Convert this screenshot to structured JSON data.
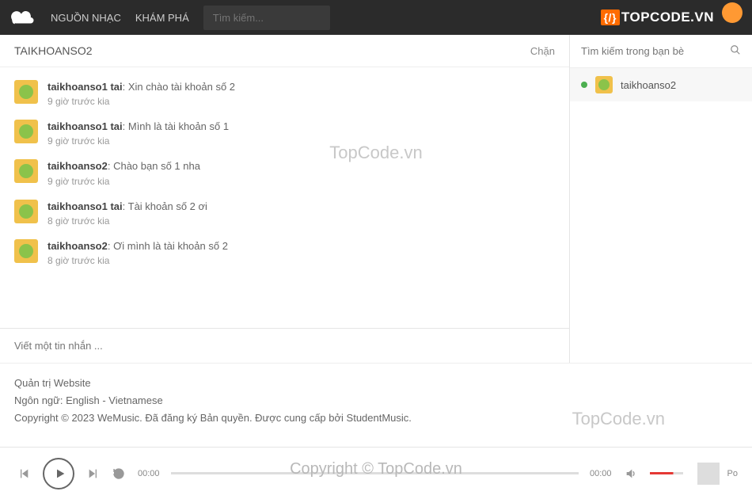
{
  "nav": {
    "link1": "NGUỒN NHẠC",
    "link2": "KHÁM PHÁ",
    "search_placeholder": "Tìm kiếm..."
  },
  "brand": {
    "text": "TOPCODE.VN"
  },
  "chat": {
    "title": "TAIKHOANSO2",
    "block": "Chặn",
    "compose_placeholder": "Viết một tin nhắn ..."
  },
  "messages": [
    {
      "user": "taikhoanso1 tai",
      "text": ": Xin chào tài khoản số 2",
      "time": "9 giờ trước kia"
    },
    {
      "user": "taikhoanso1 tai",
      "text": ": Mình là tài khoản số 1",
      "time": "9 giờ trước kia"
    },
    {
      "user": "taikhoanso2",
      "text": ": Chào bạn số 1 nha",
      "time": "9 giờ trước kia"
    },
    {
      "user": "taikhoanso1 tai",
      "text": ": Tài khoản số 2 ơi",
      "time": "8 giờ trước kia"
    },
    {
      "user": "taikhoanso2",
      "text": ": Ơi mình là tài khoản số 2",
      "time": "8 giờ trước kia"
    }
  ],
  "friends": {
    "search_placeholder": "Tìm kiếm trong bạn bè",
    "items": [
      {
        "name": "taikhoanso2"
      }
    ]
  },
  "footer": {
    "admin": "Quản trị Website",
    "lang_label": "Ngôn ngữ:",
    "lang_en": "English",
    "lang_sep": " - ",
    "lang_vi": "Vietnamese",
    "copyright_a": "Copyright © 2023 WeMusic. Đã đăng ký Bản quyền. Được cung cấp bởi ",
    "copyright_b": "StudentMusic",
    "copyright_c": "."
  },
  "player": {
    "time_start": "00:00",
    "time_end": "00:00",
    "right": "Po"
  },
  "watermarks": {
    "mid": "TopCode.vn",
    "br": "TopCode.vn",
    "player": "Copyright © TopCode.vn"
  }
}
